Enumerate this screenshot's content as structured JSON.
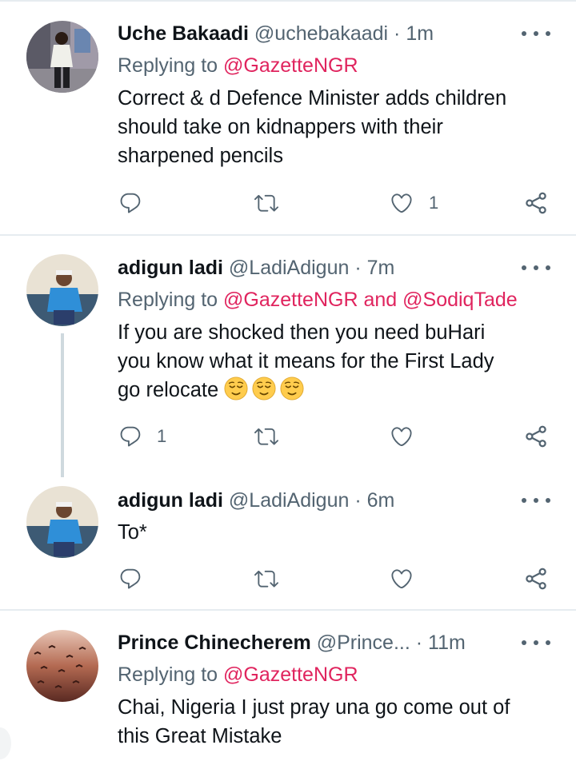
{
  "colors": {
    "accent": "#e0245e",
    "muted": "#536471",
    "text": "#0f1419",
    "divider": "#e6ecf0"
  },
  "tweets": [
    {
      "name": "Uche Bakaadi",
      "handle": "@uchebakaadi",
      "sep": "·",
      "time": "1m",
      "replying_prefix": "Replying to",
      "mentions": [
        "@GazetteNGR"
      ],
      "lines": [
        "Correct & d Defence Minister adds children",
        "should take on kidnappers with their",
        "sharpened pencils"
      ],
      "actions": {
        "reply_count": "",
        "retweet_count": "",
        "like_count": "1"
      },
      "avatar_icon": "user-photo"
    },
    {
      "name": "adigun ladi",
      "handle": "@LadiAdigun",
      "sep": "·",
      "time": "7m",
      "replying_prefix": "Replying to",
      "mentions": [
        "@GazetteNGR",
        "@SodiqTade"
      ],
      "mention_joiner": "and",
      "lines": [
        "If you are shocked then you need buHari",
        "you know what it means for the First Lady",
        "go relocate"
      ],
      "emoji": [
        "relieved-face-icon",
        "relieved-face-icon",
        "relieved-face-icon"
      ],
      "actions": {
        "reply_count": "1",
        "retweet_count": "",
        "like_count": ""
      },
      "avatar_icon": "user-photo"
    },
    {
      "name": "adigun ladi",
      "handle": "@LadiAdigun",
      "sep": "·",
      "time": "6m",
      "lines": [
        "To*"
      ],
      "actions": {
        "reply_count": "",
        "retweet_count": "",
        "like_count": ""
      },
      "avatar_icon": "user-photo"
    },
    {
      "name": "Prince Chinecherem",
      "handle": "@Prince...",
      "sep": "·",
      "time": "11m",
      "replying_prefix": "Replying to",
      "mentions": [
        "@GazetteNGR"
      ],
      "lines": [
        "Chai, Nigeria I just pray una go come out of",
        "this Great Mistake"
      ],
      "avatar_icon": "user-photo"
    }
  ],
  "icons": {
    "reply": "reply-icon",
    "retweet": "retweet-icon",
    "like": "heart-icon",
    "share": "share-icon",
    "more": "more-icon"
  }
}
